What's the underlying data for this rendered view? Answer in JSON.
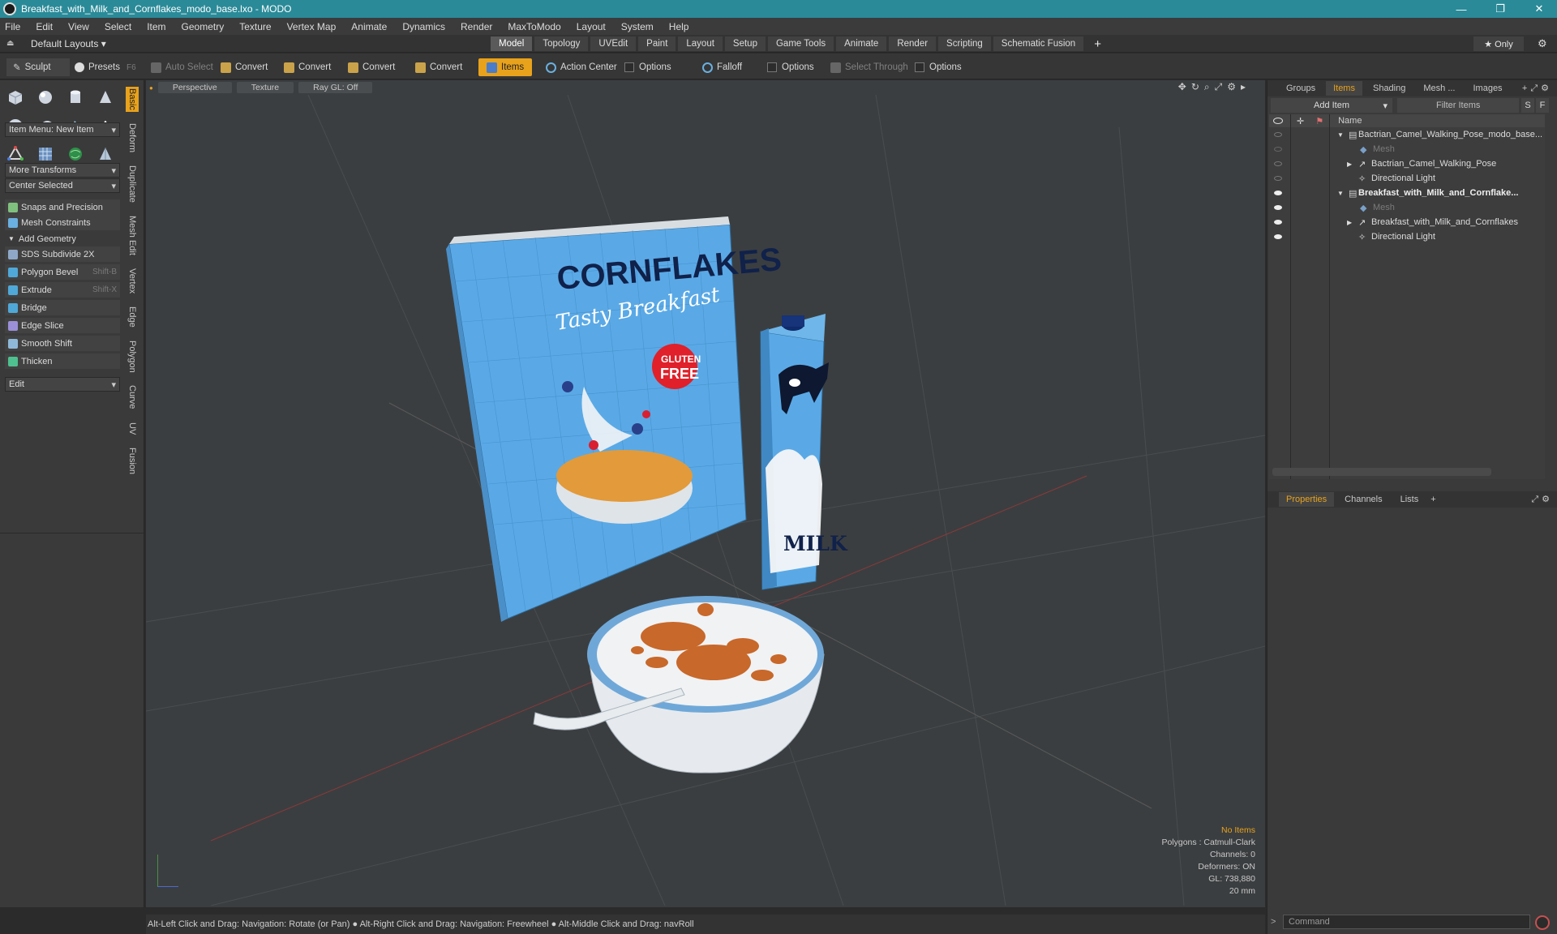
{
  "window": {
    "title": "Breakfast_with_Milk_and_Cornflakes_modo_base.lxo - MODO",
    "controls": {
      "minimize": "—",
      "restore": "❐",
      "close": "✕"
    }
  },
  "menu": [
    "File",
    "Edit",
    "View",
    "Select",
    "Item",
    "Geometry",
    "Texture",
    "Vertex Map",
    "Animate",
    "Dynamics",
    "Render",
    "MaxToModo",
    "Layout",
    "System",
    "Help"
  ],
  "layout_bar": {
    "default_layouts": "Default Layouts ▾",
    "tabs": [
      "Model",
      "Topology",
      "UVEdit",
      "Paint",
      "Layout",
      "Setup",
      "Game Tools",
      "Animate",
      "Render",
      "Scripting",
      "Schematic Fusion"
    ],
    "active_tab": "Model",
    "add": "+",
    "only": "★ Only"
  },
  "toolbar": {
    "sculpt": "Sculpt",
    "presets": "Presets",
    "presets_key": "F6",
    "auto_select": "Auto Select",
    "convert1": "Convert",
    "convert2": "Convert",
    "convert3": "Convert",
    "convert4": "Convert",
    "items": "Items",
    "action_center": "Action Center",
    "options1": "Options",
    "falloff": "Falloff",
    "options2": "Options",
    "select_through": "Select Through",
    "options3": "Options"
  },
  "left_panel": {
    "vertical_tabs": [
      "Basic",
      "Deform",
      "Duplicate",
      "Mesh Edit",
      "Vertex",
      "Edge",
      "Polygon",
      "Curve",
      "UV",
      "Fusion"
    ],
    "item_menu": "Item Menu: New Item",
    "more_transforms": "More Transforms",
    "center_selected": "Center Selected",
    "snaps": "Snaps and Precision",
    "mesh_constraints": "Mesh Constraints",
    "add_geometry": "Add Geometry",
    "tools": [
      {
        "label": "SDS Subdivide 2X",
        "shortcut": ""
      },
      {
        "label": "Polygon Bevel",
        "shortcut": "Shift-B"
      },
      {
        "label": "Extrude",
        "shortcut": "Shift-X"
      },
      {
        "label": "Bridge",
        "shortcut": ""
      },
      {
        "label": "Edge Slice",
        "shortcut": ""
      },
      {
        "label": "Smooth Shift",
        "shortcut": ""
      },
      {
        "label": "Thicken",
        "shortcut": ""
      }
    ],
    "edit": "Edit"
  },
  "viewport": {
    "view": "Perspective",
    "shading": "Texture",
    "raygl": "Ray GL: Off",
    "scene": {
      "cereal_title": "CORNFLAKES",
      "cereal_sub": "Tasty Breakfast",
      "badge1": "GLUTEN",
      "badge2": "FREE",
      "milk_label": "MILK"
    },
    "stats": {
      "no_items": "No Items",
      "polygons": "Polygons : Catmull-Clark",
      "channels": "Channels: 0",
      "deformers": "Deformers: ON",
      "gl": "GL: 738,880",
      "unit": "20 mm"
    }
  },
  "right_panel": {
    "tabs": [
      "Groups",
      "Items",
      "Shading",
      "Mesh ...",
      "Images"
    ],
    "active_tab": "Items",
    "add_item": "Add Item",
    "filter_items": "Filter Items",
    "s": "S",
    "f": "F",
    "name_col": "Name",
    "tree": [
      {
        "label": "Bactrian_Camel_Walking_Pose_modo_base...",
        "indent": 0,
        "bold": false,
        "dim": false
      },
      {
        "label": "Mesh",
        "indent": 1,
        "bold": false,
        "dim": true
      },
      {
        "label": "Bactrian_Camel_Walking_Pose",
        "indent": 1,
        "bold": false,
        "dim": false
      },
      {
        "label": "Directional Light",
        "indent": 1,
        "bold": false,
        "dim": false
      },
      {
        "label": "Breakfast_with_Milk_and_Cornflake...",
        "indent": 0,
        "bold": true,
        "dim": false
      },
      {
        "label": "Mesh",
        "indent": 1,
        "bold": false,
        "dim": true
      },
      {
        "label": "Breakfast_with_Milk_and_Cornflakes",
        "indent": 1,
        "bold": false,
        "dim": false
      },
      {
        "label": "Directional Light",
        "indent": 1,
        "bold": false,
        "dim": false
      }
    ],
    "prop_tabs": [
      "Properties",
      "Channels",
      "Lists"
    ],
    "prop_active": "Properties"
  },
  "statusbar": "Alt-Left Click and Drag: Navigation: Rotate (or Pan) ● Alt-Right Click and Drag: Navigation: Freewheel ● Alt-Middle Click and Drag: navRoll",
  "command_placeholder": "Command",
  "colors": {
    "titlebar": "#2a8a98",
    "accent": "#e8a21c",
    "box_blue": "#5aa9e6"
  }
}
